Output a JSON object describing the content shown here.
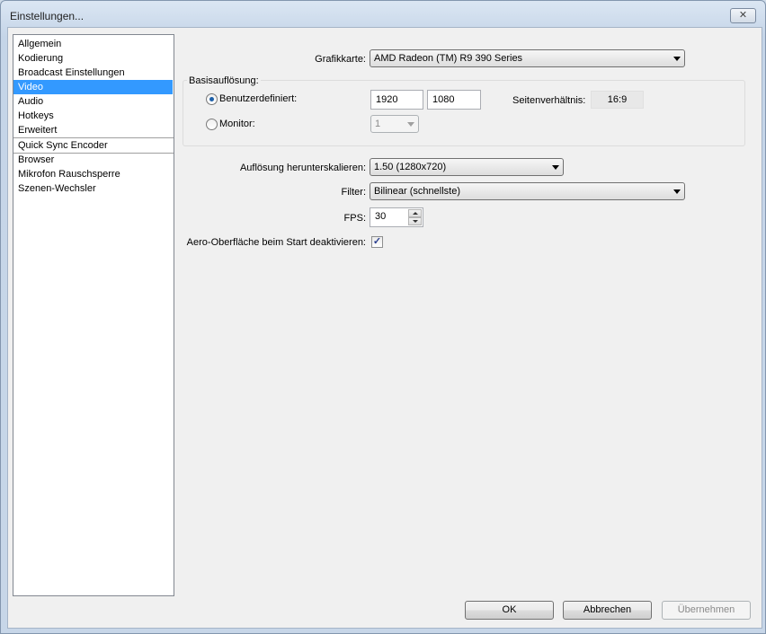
{
  "window": {
    "title": "Einstellungen..."
  },
  "nav": {
    "items": [
      {
        "label": "Allgemein",
        "selected": false
      },
      {
        "label": "Kodierung",
        "selected": false
      },
      {
        "label": "Broadcast Einstellungen",
        "selected": false
      },
      {
        "label": "Video",
        "selected": true
      },
      {
        "label": "Audio",
        "selected": false
      },
      {
        "label": "Hotkeys",
        "selected": false
      },
      {
        "label": "Erweitert",
        "selected": false
      },
      {
        "label": "Quick Sync Encoder",
        "selected": false
      },
      {
        "label": "Browser",
        "selected": false
      },
      {
        "label": "Mikrofon Rauschsperre",
        "selected": false
      },
      {
        "label": "Szenen-Wechsler",
        "selected": false
      }
    ]
  },
  "video": {
    "gpu_label": "Grafikkarte:",
    "gpu_value": "AMD Radeon (TM) R9 390 Series",
    "base_res_title": "Basisauflösung:",
    "custom_label": "Benutzerdefiniert:",
    "width_value": "1920",
    "height_value": "1080",
    "aspect_label": "Seitenverhältnis:",
    "aspect_value": "16:9",
    "monitor_label": "Monitor:",
    "monitor_value": "1",
    "downscale_label": "Auflösung herunterskalieren:",
    "downscale_value": "1.50  (1280x720)",
    "filter_label": "Filter:",
    "filter_value": "Bilinear (schnellste)",
    "fps_label": "FPS:",
    "fps_value": "30",
    "aero_label": "Aero-Oberfläche beim Start deaktivieren:",
    "aero_checked": true
  },
  "buttons": {
    "ok": "OK",
    "cancel": "Abbrechen",
    "apply": "Übernehmen"
  },
  "icons": {
    "close": "close-icon",
    "checkmark": "check-icon"
  }
}
